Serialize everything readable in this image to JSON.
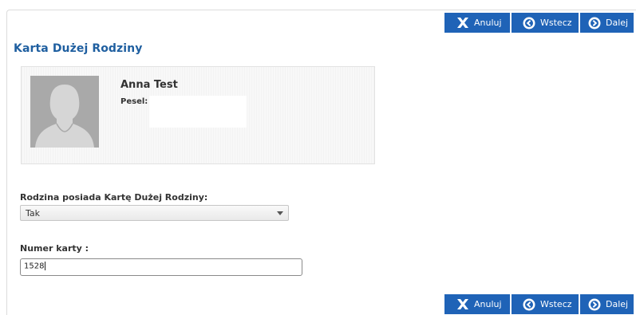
{
  "toolbar": {
    "cancel_label": "Anuluj",
    "back_label": "Wstecz",
    "next_label": "Dalej"
  },
  "page": {
    "title": "Karta Dużej Rodziny"
  },
  "person": {
    "name": "Anna Test",
    "pesel_label": "Pesel:",
    "pesel_value": ""
  },
  "form": {
    "family_card_label": "Rodzina posiada Kartę Dużej Rodziny:",
    "family_card_selected": "Tak",
    "card_number_label": "Numer karty :",
    "card_number_value": "1528"
  },
  "colors": {
    "button_bg": "#1f63b7",
    "title": "#1f5fa0"
  }
}
